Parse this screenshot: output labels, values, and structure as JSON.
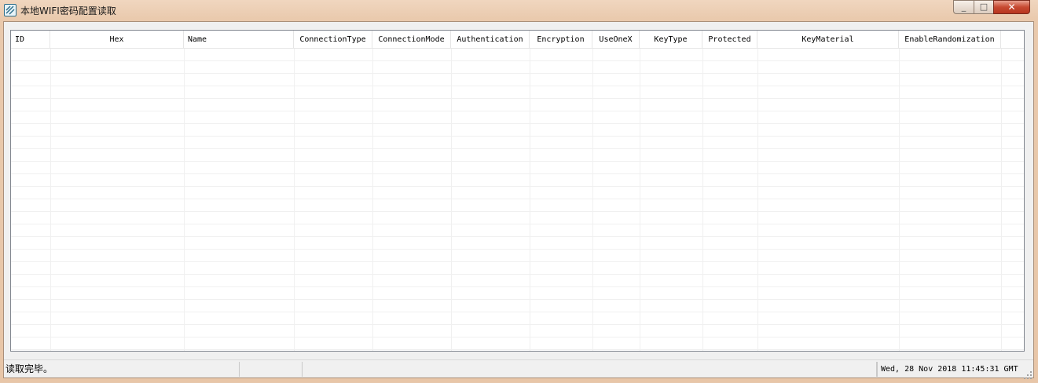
{
  "window": {
    "title": "本地WIFI密码配置读取",
    "minimize_glyph": "_",
    "maximize_glyph": "□",
    "close_glyph": "✕"
  },
  "listview": {
    "columns": [
      {
        "label": "ID"
      },
      {
        "label": "Hex"
      },
      {
        "label": "Name"
      },
      {
        "label": "ConnectionType"
      },
      {
        "label": "ConnectionMode"
      },
      {
        "label": "Authentication"
      },
      {
        "label": "Encryption"
      },
      {
        "label": "UseOneX"
      },
      {
        "label": "KeyType"
      },
      {
        "label": "Protected"
      },
      {
        "label": "KeyMaterial"
      },
      {
        "label": "EnableRandomization"
      }
    ],
    "rows": []
  },
  "statusbar": {
    "message": "读取完毕。",
    "panel2": "",
    "panel3": "",
    "datetime": "Wed, 28 Nov 2018 11:45:31 GMT"
  },
  "colors": {
    "frame": "#e8c6a8",
    "client": "#f0f0f0",
    "close_button": "#c74a32",
    "grid_line": "#f0f0f0"
  },
  "icons": [
    "app-icon",
    "minimize-icon",
    "maximize-icon",
    "close-icon",
    "size-grip-icon"
  ]
}
